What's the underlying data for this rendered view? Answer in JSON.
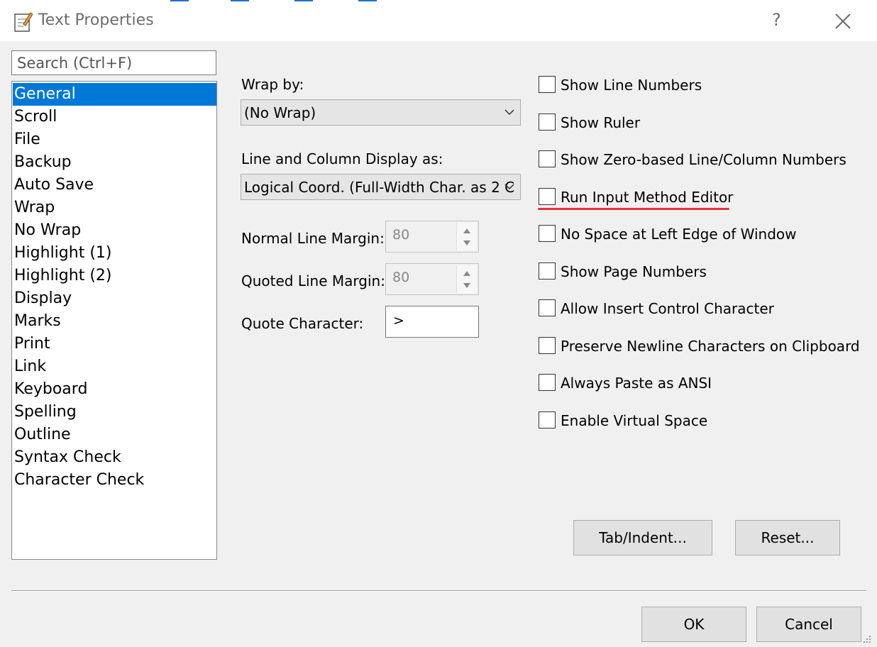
{
  "window": {
    "title": "Text Properties",
    "help_label": "?"
  },
  "search": {
    "placeholder": "Search (Ctrl+F)"
  },
  "categories": [
    "General",
    "Scroll",
    "File",
    "Backup",
    "Auto Save",
    "Wrap",
    "No Wrap",
    "Highlight (1)",
    "Highlight (2)",
    "Display",
    "Marks",
    "Print",
    "Link",
    "Keyboard",
    "Spelling",
    "Outline",
    "Syntax Check",
    "Character Check"
  ],
  "selected_category": "General",
  "wrap": {
    "label": "Wrap by:",
    "value": "(No Wrap)"
  },
  "line_column": {
    "label": "Line and Column Display as:",
    "value": "Logical Coord. (Full-Width Char. as 2 C"
  },
  "normal_margin": {
    "label": "Normal Line Margin:",
    "value": "80"
  },
  "quoted_margin": {
    "label": "Quoted Line Margin:",
    "value": "80"
  },
  "quote_char": {
    "label": "Quote Character:",
    "value": ">"
  },
  "options": [
    {
      "label": "Show Line Numbers",
      "checked": false
    },
    {
      "label": "Show Ruler",
      "checked": false
    },
    {
      "label": "Show Zero-based Line/Column Numbers",
      "checked": false
    },
    {
      "label": "Run Input Method Editor",
      "checked": false
    },
    {
      "label": "No Space at Left Edge of Window",
      "checked": false
    },
    {
      "label": "Show Page Numbers",
      "checked": false
    },
    {
      "label": "Allow Insert Control Character",
      "checked": false
    },
    {
      "label": "Preserve Newline Characters on Clipboard",
      "checked": false
    },
    {
      "label": "Always Paste as ANSI",
      "checked": false
    },
    {
      "label": "Enable Virtual Space",
      "checked": false
    }
  ],
  "buttons": {
    "tab_indent": "Tab/Indent...",
    "reset": "Reset...",
    "ok": "OK",
    "cancel": "Cancel"
  },
  "colors": {
    "selection": "#0078d7",
    "annotation": "#e8323c"
  }
}
